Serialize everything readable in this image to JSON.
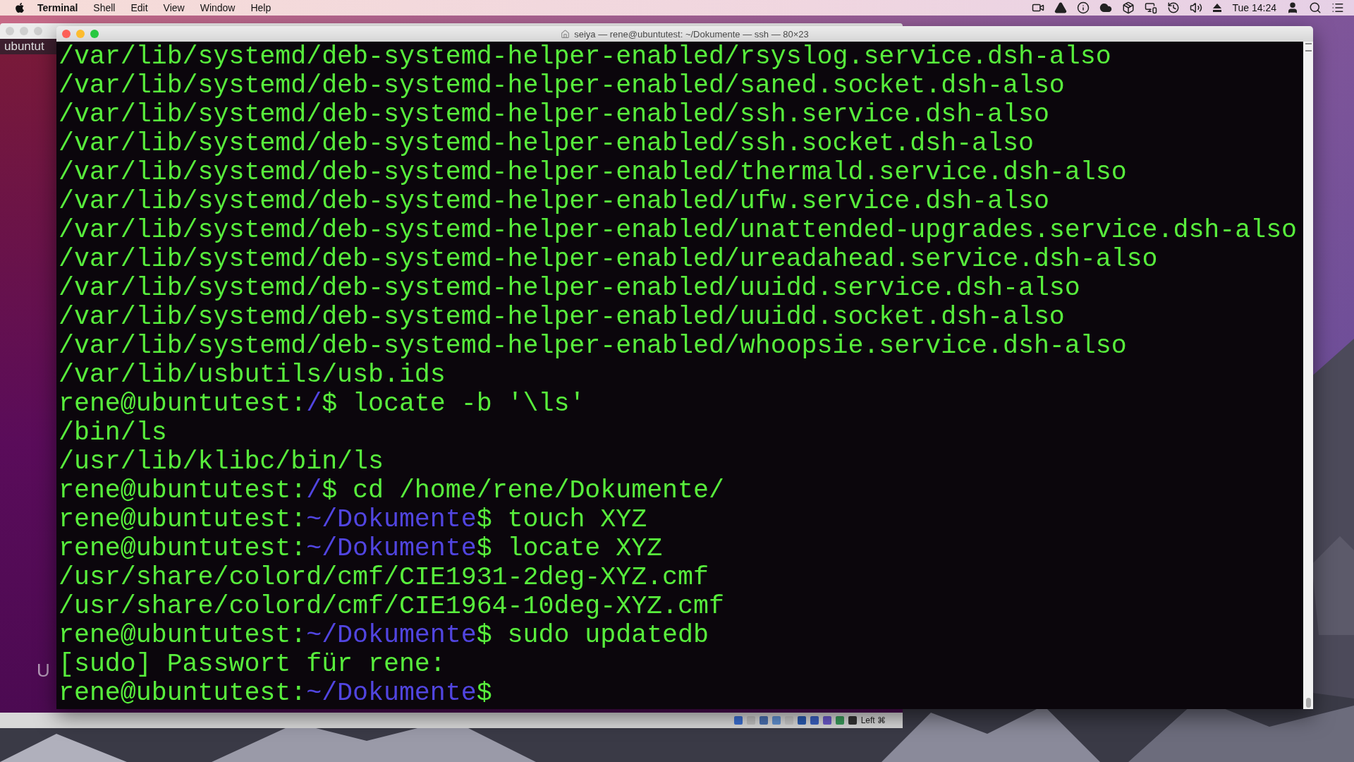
{
  "menu_bar": {
    "menus": [
      {
        "label": "Terminal",
        "kind": "app"
      },
      {
        "label": "Shell",
        "kind": "menu"
      },
      {
        "label": "Edit",
        "kind": "menu"
      },
      {
        "label": "View",
        "kind": "menu"
      },
      {
        "label": "Window",
        "kind": "menu"
      },
      {
        "label": "Help",
        "kind": "menu"
      }
    ],
    "clock": "Tue 14:24"
  },
  "background_window": {
    "top_bar_label": "ubuntut",
    "faint_label": "U",
    "status_bar": {
      "host_key": "Left ⌘"
    }
  },
  "terminal": {
    "title": "seiya — rene@ubuntutest: ~/Dokumente — ssh — 80×23",
    "lines": [
      {
        "segments": [
          {
            "text": "/var/lib/systemd/deb-systemd-helper-enabled/rsyslog.service.dsh-also",
            "kind": "plain"
          }
        ]
      },
      {
        "segments": [
          {
            "text": "/var/lib/systemd/deb-systemd-helper-enabled/saned.socket.dsh-also",
            "kind": "plain"
          }
        ]
      },
      {
        "segments": [
          {
            "text": "/var/lib/systemd/deb-systemd-helper-enabled/ssh.service.dsh-also",
            "kind": "plain"
          }
        ]
      },
      {
        "segments": [
          {
            "text": "/var/lib/systemd/deb-systemd-helper-enabled/ssh.socket.dsh-also",
            "kind": "plain"
          }
        ]
      },
      {
        "segments": [
          {
            "text": "/var/lib/systemd/deb-systemd-helper-enabled/thermald.service.dsh-also",
            "kind": "plain"
          }
        ]
      },
      {
        "segments": [
          {
            "text": "/var/lib/systemd/deb-systemd-helper-enabled/ufw.service.dsh-also",
            "kind": "plain"
          }
        ]
      },
      {
        "segments": [
          {
            "text": "/var/lib/systemd/deb-systemd-helper-enabled/unattended-upgrades.service.dsh-also",
            "kind": "plain"
          }
        ]
      },
      {
        "segments": [
          {
            "text": "/var/lib/systemd/deb-systemd-helper-enabled/ureadahead.service.dsh-also",
            "kind": "plain"
          }
        ]
      },
      {
        "segments": [
          {
            "text": "/var/lib/systemd/deb-systemd-helper-enabled/uuidd.service.dsh-also",
            "kind": "plain"
          }
        ]
      },
      {
        "segments": [
          {
            "text": "/var/lib/systemd/deb-systemd-helper-enabled/uuidd.socket.dsh-also",
            "kind": "plain"
          }
        ]
      },
      {
        "segments": [
          {
            "text": "/var/lib/systemd/deb-systemd-helper-enabled/whoopsie.service.dsh-also",
            "kind": "plain"
          }
        ]
      },
      {
        "segments": [
          {
            "text": "/var/lib/usbutils/usb.ids",
            "kind": "plain"
          }
        ]
      },
      {
        "segments": [
          {
            "text": "rene@ubuntutest:",
            "kind": "plain"
          },
          {
            "text": "/",
            "kind": "path"
          },
          {
            "text": "$ locate -b '\\ls'",
            "kind": "plain"
          }
        ]
      },
      {
        "segments": [
          {
            "text": "/bin/ls",
            "kind": "plain"
          }
        ]
      },
      {
        "segments": [
          {
            "text": "/usr/lib/klibc/bin/ls",
            "kind": "plain"
          }
        ]
      },
      {
        "segments": [
          {
            "text": "rene@ubuntutest:",
            "kind": "plain"
          },
          {
            "text": "/",
            "kind": "path"
          },
          {
            "text": "$ cd /home/rene/Dokumente/",
            "kind": "plain"
          }
        ]
      },
      {
        "segments": [
          {
            "text": "rene@ubuntutest:",
            "kind": "plain"
          },
          {
            "text": "~/Dokumente",
            "kind": "path"
          },
          {
            "text": "$ touch XYZ",
            "kind": "plain"
          }
        ]
      },
      {
        "segments": [
          {
            "text": "rene@ubuntutest:",
            "kind": "plain"
          },
          {
            "text": "~/Dokumente",
            "kind": "path"
          },
          {
            "text": "$ locate XYZ",
            "kind": "plain"
          }
        ]
      },
      {
        "segments": [
          {
            "text": "/usr/share/colord/cmf/CIE1931-2deg-XYZ.cmf",
            "kind": "plain"
          }
        ]
      },
      {
        "segments": [
          {
            "text": "/usr/share/colord/cmf/CIE1964-10deg-XYZ.cmf",
            "kind": "plain"
          }
        ]
      },
      {
        "segments": [
          {
            "text": "rene@ubuntutest:",
            "kind": "plain"
          },
          {
            "text": "~/Dokumente",
            "kind": "path"
          },
          {
            "text": "$ sudo updatedb",
            "kind": "plain"
          }
        ]
      },
      {
        "segments": [
          {
            "text": "[sudo] Passwort für rene:",
            "kind": "plain"
          }
        ]
      },
      {
        "segments": [
          {
            "text": "rene@ubuntutest:",
            "kind": "plain"
          },
          {
            "text": "~/Dokumente",
            "kind": "path"
          },
          {
            "text": "$",
            "kind": "plain"
          }
        ]
      }
    ]
  }
}
